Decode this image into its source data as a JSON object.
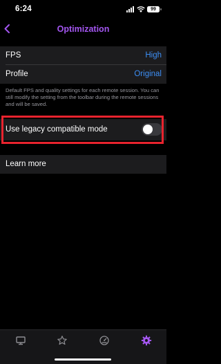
{
  "status_bar": {
    "time": "6:24",
    "battery": "99",
    "icons": [
      "signal-icon",
      "wifi-icon",
      "battery-icon"
    ]
  },
  "nav": {
    "title": "Optimization",
    "back_icon": "chevron-left-icon"
  },
  "settings": {
    "fps": {
      "label": "FPS",
      "value": "High"
    },
    "profile": {
      "label": "Profile",
      "value": "Original"
    },
    "footnote": "Default FPS and quality settings for each remote session. You can still modify the setting from the toolbar during the remote sessions and will be saved.",
    "legacy_mode": {
      "label": "Use legacy compatible mode",
      "enabled": false
    },
    "learn_more": "Learn more"
  },
  "tab_bar": {
    "tabs": [
      {
        "icon": "monitor-icon",
        "active": false
      },
      {
        "icon": "star-icon",
        "active": false
      },
      {
        "icon": "speedometer-icon",
        "active": false
      },
      {
        "icon": "gear-icon",
        "active": true
      }
    ]
  },
  "colors": {
    "accent": "#a356f0",
    "link": "#3d8ff5",
    "highlight": "#e8232e"
  }
}
